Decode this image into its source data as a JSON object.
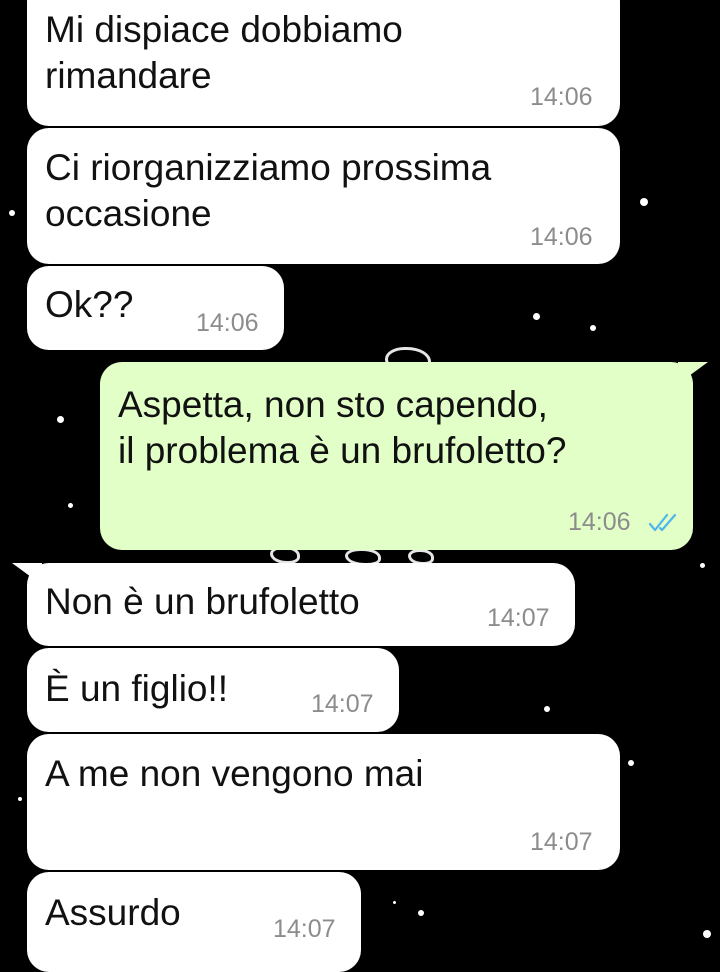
{
  "chat": {
    "messages": [
      {
        "direction": "incoming",
        "text": "Mi dispiace dobbiamo\nrimandare",
        "time": "14:06"
      },
      {
        "direction": "incoming",
        "text": "Ci riorganizziamo prossima\noccasione",
        "time": "14:06"
      },
      {
        "direction": "incoming",
        "text": "Ok??",
        "time": "14:06"
      },
      {
        "direction": "outgoing",
        "text": "Aspetta, non sto capendo,\nil problema è un brufoletto?",
        "time": "14:06",
        "status": "read"
      },
      {
        "direction": "incoming",
        "text": "Non è un brufoletto",
        "time": "14:07"
      },
      {
        "direction": "incoming",
        "text": "È un figlio!!",
        "time": "14:07"
      },
      {
        "direction": "incoming",
        "text": "A me non vengono mai",
        "time": "14:07"
      },
      {
        "direction": "incoming",
        "text": "Assurdo",
        "time": "14:07"
      }
    ]
  },
  "colors": {
    "background": "#000000",
    "incoming_bubble": "#ffffff",
    "outgoing_bubble": "#e1ffc7",
    "timestamp": "#8c8c8c",
    "read_ticks": "#4fb6ec"
  },
  "icons": {
    "read_receipt": "double-check-icon"
  }
}
